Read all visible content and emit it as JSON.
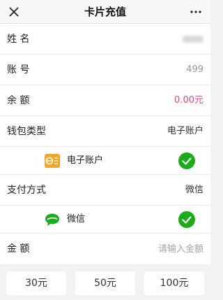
{
  "header": {
    "title": "卡片充值",
    "close_icon": "close-icon",
    "more_icon": "more-icon"
  },
  "fields": {
    "name": {
      "label": "姓 名",
      "value": ""
    },
    "account": {
      "label": "账 号",
      "value": "499"
    },
    "balance": {
      "label": "余 额",
      "value": "0.00元",
      "color": "#e8467c"
    },
    "wallet_type": {
      "label": "钱包类型",
      "value": "电子账户"
    },
    "wallet_option": {
      "name": "电子账户",
      "icon": "e-wallet-icon",
      "selected": true,
      "icon_color": "#f5a623"
    },
    "pay_method": {
      "label": "支付方式",
      "value": "微信"
    },
    "pay_option": {
      "name": "微信",
      "icon": "wechat-icon",
      "selected": true,
      "icon_color": "#1aad19"
    },
    "amount": {
      "label": "金 额",
      "placeholder": "请输入金额",
      "value": ""
    }
  },
  "presets": [
    "30元",
    "50元",
    "100元"
  ],
  "colors": {
    "check": "#1aad19",
    "accent_pink": "#e8467c"
  }
}
